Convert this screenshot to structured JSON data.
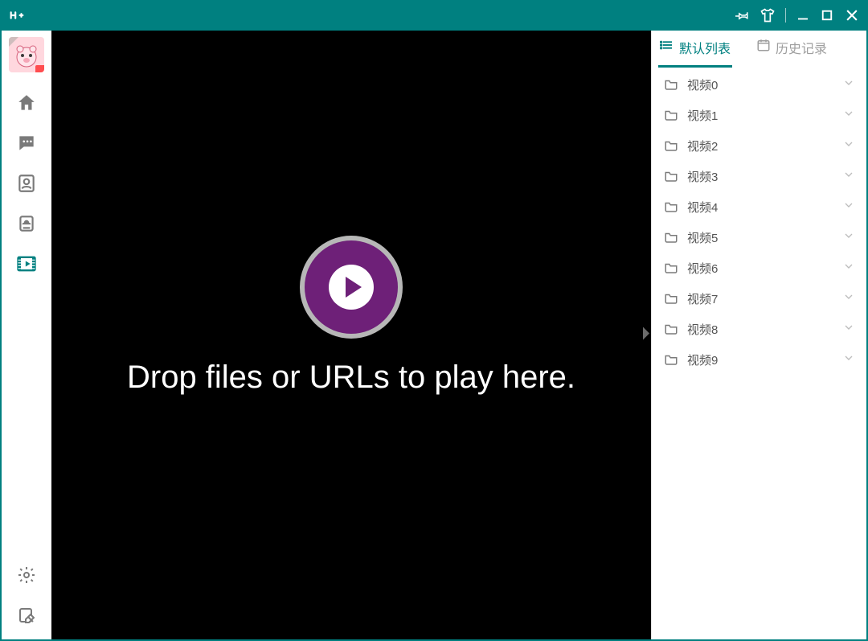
{
  "titlebar": {
    "logo_icon": "app-logo-icon",
    "controls": {
      "pin": "pin-icon",
      "theme": "shirt-icon",
      "minimize": "minimize-icon",
      "maximize": "maximize-icon",
      "close": "close-icon"
    }
  },
  "nav": {
    "items": [
      {
        "name": "home-icon",
        "active": false
      },
      {
        "name": "chat-icon",
        "active": false
      },
      {
        "name": "contacts-icon",
        "active": false
      },
      {
        "name": "cloud-icon",
        "active": false
      },
      {
        "name": "video-icon",
        "active": true
      }
    ],
    "bottom": [
      {
        "name": "settings-icon"
      },
      {
        "name": "edit-icon"
      }
    ]
  },
  "player": {
    "drop_text": "Drop files or URLs to play here."
  },
  "panel": {
    "tabs": [
      {
        "label": "默认列表",
        "icon": "list-icon",
        "active": true
      },
      {
        "label": "历史记录",
        "icon": "history-icon",
        "active": false
      }
    ],
    "items": [
      {
        "label": "视频0"
      },
      {
        "label": "视频1"
      },
      {
        "label": "视频2"
      },
      {
        "label": "视频3"
      },
      {
        "label": "视频4"
      },
      {
        "label": "视频5"
      },
      {
        "label": "视频6"
      },
      {
        "label": "视频7"
      },
      {
        "label": "视频8"
      },
      {
        "label": "视频9"
      }
    ]
  }
}
